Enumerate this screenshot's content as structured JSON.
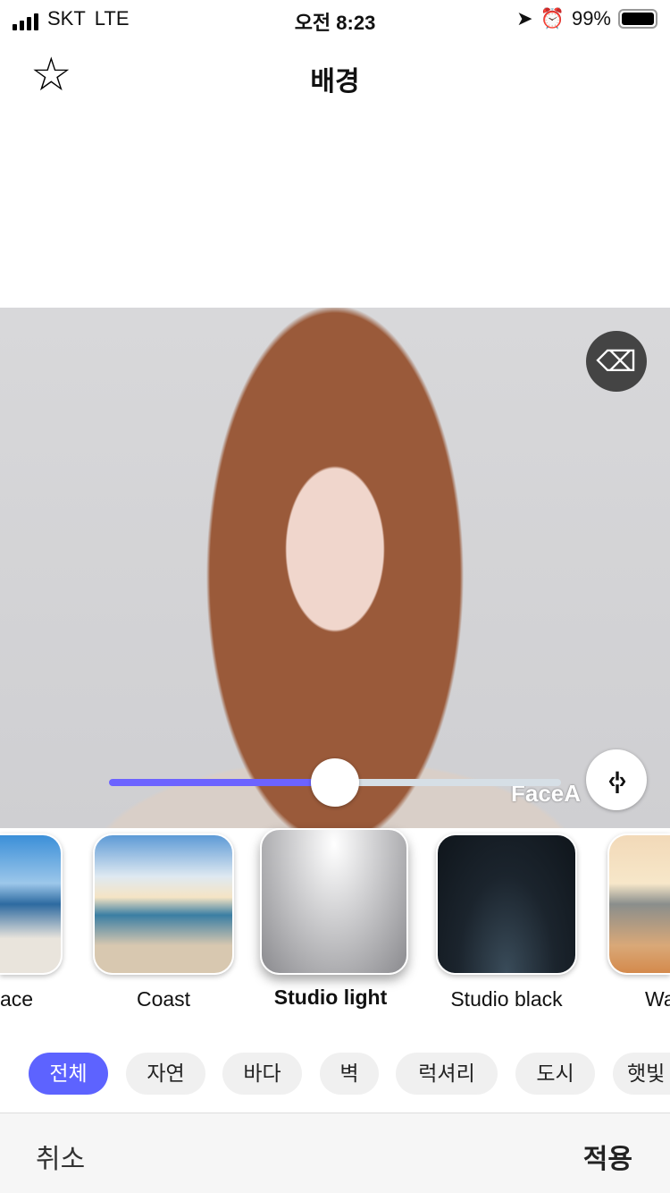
{
  "status": {
    "carrier": "SKT",
    "network": "LTE",
    "time": "오전 8:23",
    "battery": "99%",
    "battery_level": 0.99
  },
  "header": {
    "title": "배경",
    "favorite_icon": "star-outline-icon"
  },
  "editor": {
    "slider_value_percent": 50,
    "watermark": "FaceA",
    "slider_color": "#6c63ff",
    "eraser_icon": "eraser-icon",
    "compare_icon": "split-compare-icon"
  },
  "backgrounds": [
    {
      "label": "ace"
    },
    {
      "label": "Coast"
    },
    {
      "label": "Studio light",
      "selected": true
    },
    {
      "label": "Studio black"
    },
    {
      "label": "Wa"
    }
  ],
  "categories": [
    {
      "label": "전체",
      "active": true
    },
    {
      "label": "자연"
    },
    {
      "label": "바다"
    },
    {
      "label": "벽"
    },
    {
      "label": "럭셔리"
    },
    {
      "label": "도시"
    },
    {
      "label": "햇빛"
    }
  ],
  "accent": "#5d63ff",
  "footer": {
    "cancel": "취소",
    "apply": "적용"
  }
}
